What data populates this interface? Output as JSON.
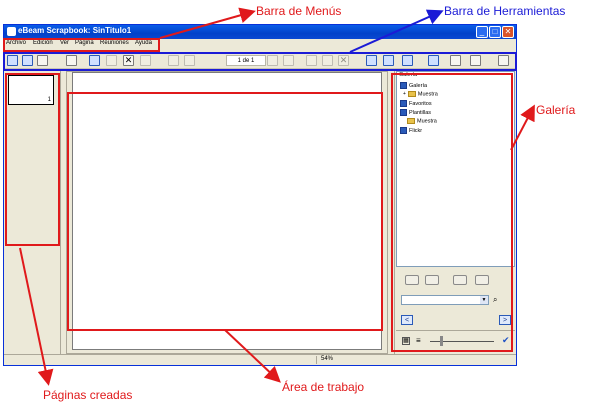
{
  "window": {
    "title": "eBeam Scrapbook: SinTitulo1"
  },
  "menu": [
    "Archivo",
    "Edición",
    "Ver",
    "Página",
    "Reuniones",
    "Ayuda"
  ],
  "toolbar": {
    "page_indicator": "1 de 1"
  },
  "pages": {
    "thumb_number": "1"
  },
  "gallery": {
    "header": "Galería",
    "tree": [
      {
        "label": "Galería",
        "level": 0,
        "kind": "check"
      },
      {
        "label": "Muestra",
        "level": 1,
        "kind": "folder"
      },
      {
        "label": "Favoritos",
        "level": 0,
        "kind": "check"
      },
      {
        "label": "Plantillas",
        "level": 0,
        "kind": "check"
      },
      {
        "label": "Muestra",
        "level": 1,
        "kind": "folder"
      },
      {
        "label": "Flickr",
        "level": 0,
        "kind": "check"
      }
    ],
    "prev": "<",
    "next": ">"
  },
  "status": {
    "zoom": "54%"
  },
  "annotations": {
    "menu_bar": "Barra de Menús",
    "toolbar": "Barra de Herramientas",
    "gallery": "Galería",
    "pages": "Páginas creadas",
    "workarea": "Área de trabajo"
  },
  "colors": {
    "annotation_red": "#e0191b",
    "annotation_blue": "#1b1bd6",
    "titlebar": "#0a5de8"
  }
}
